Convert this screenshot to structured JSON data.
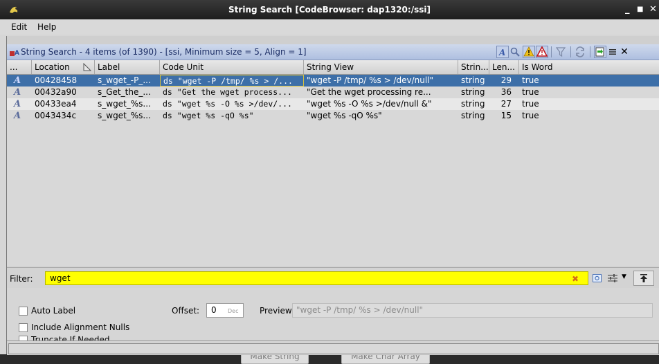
{
  "window": {
    "title": "String Search [CodeBrowser: dap1320:/ssi]",
    "minimize": "_",
    "maximize": "■",
    "close": "✕"
  },
  "menu": {
    "edit": "Edit",
    "help": "Help"
  },
  "provider": {
    "title": "String Search - 4 items (of 1390) - [ssi, Minimum size = 5, Align = 1]"
  },
  "table": {
    "headers": [
      "...",
      "Location",
      "Label",
      "Code Unit",
      "String View",
      "Strin...",
      "Len...",
      "Is Word"
    ],
    "rows": [
      {
        "location": "00428458",
        "label": "s_wget_-P_...",
        "code_unit": "ds \"wget -P /tmp/ %s > /...",
        "string_view": "\"wget -P /tmp/ %s > /dev/null\"",
        "type": "string",
        "length": "29",
        "is_word": "true"
      },
      {
        "location": "00432a90",
        "label": "s_Get_the_...",
        "code_unit": "ds \"Get the wget process...",
        "string_view": "\"Get the wget processing re...",
        "type": "string",
        "length": "36",
        "is_word": "true"
      },
      {
        "location": "00433ea4",
        "label": "s_wget_%s...",
        "code_unit": "ds \"wget %s -O %s >/dev/...",
        "string_view": "\"wget %s -O %s >/dev/null &\"",
        "type": "string",
        "length": "27",
        "is_word": "true"
      },
      {
        "location": "0043434c",
        "label": "s_wget_%s...",
        "code_unit": "ds \"wget %s -qO %s\"",
        "string_view": "\"wget %s -qO %s\"",
        "type": "string",
        "length": "15",
        "is_word": "true"
      }
    ]
  },
  "filter": {
    "label": "Filter:",
    "value": "wget"
  },
  "options": {
    "auto_label": "Auto Label",
    "include_nulls": "Include Alignment Nulls",
    "truncate": "Truncate If Needed",
    "offset_label": "Offset:",
    "offset_value": "0",
    "offset_unit": "Dec",
    "preview_label": "Preview:",
    "preview_value": "\"wget -P /tmp/ %s > /dev/null\""
  },
  "buttons": {
    "make_string": "Make String",
    "make_char_array": "Make Char Array"
  },
  "colors": {
    "selection": "#3d6fa8",
    "filter_bg": "#ffff00",
    "header_bg": "#aebfe0"
  }
}
